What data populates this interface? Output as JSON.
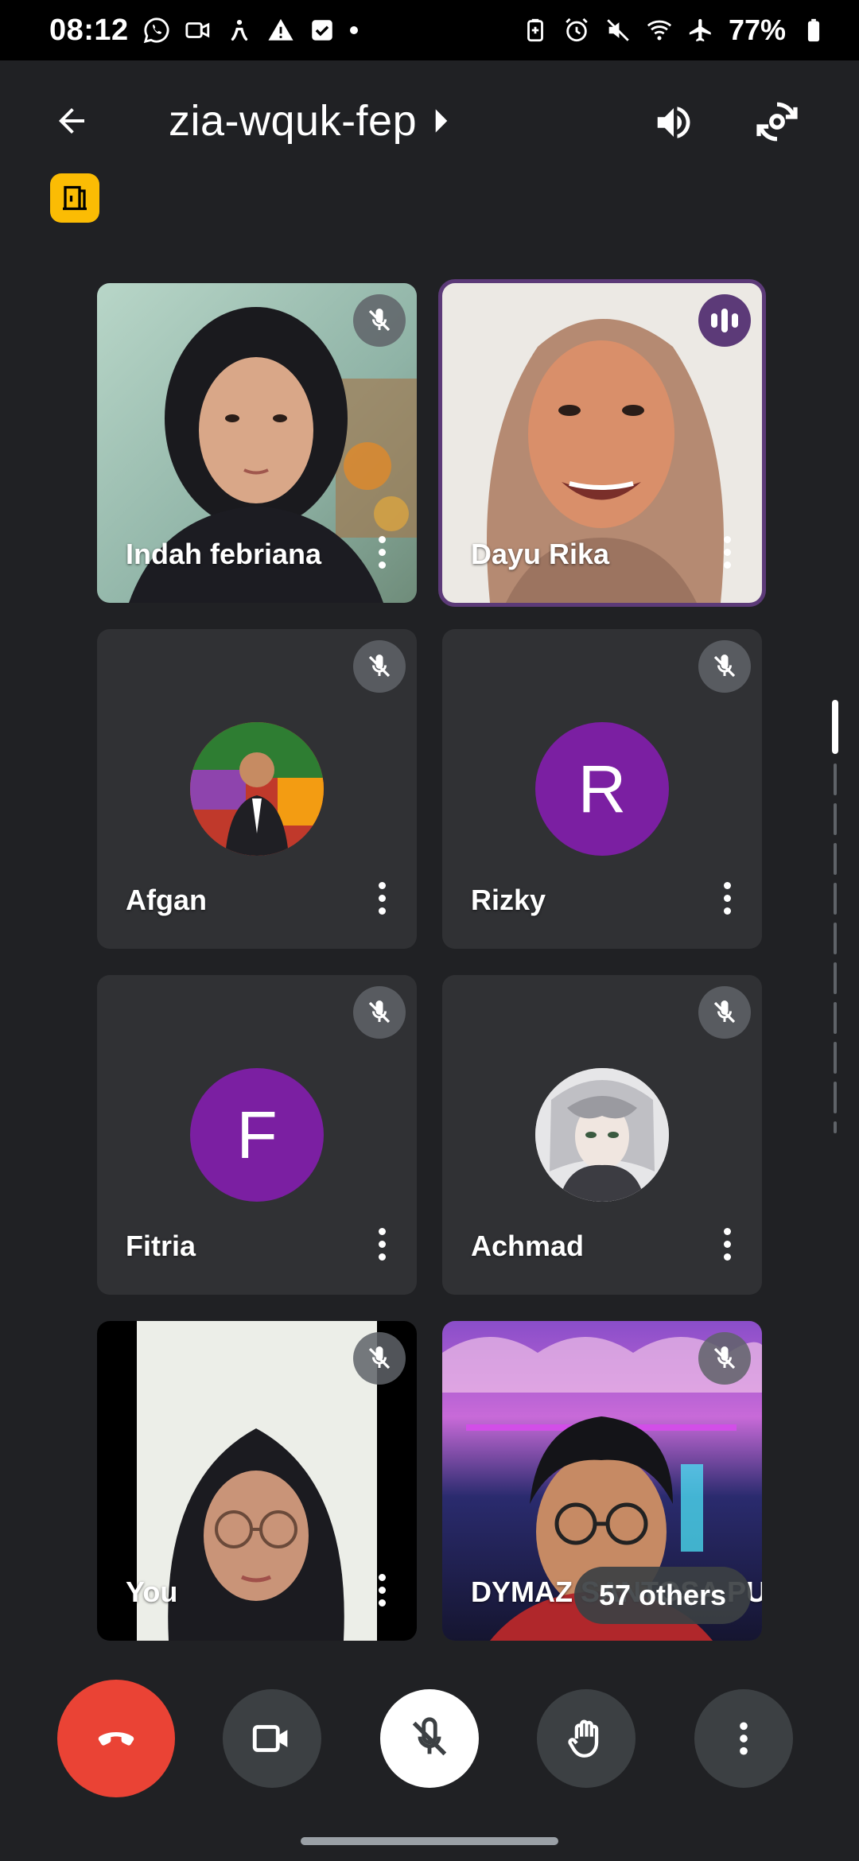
{
  "status_bar": {
    "time": "08:12",
    "battery": "77%",
    "left_icons": [
      "whatsapp-icon",
      "video-call-icon",
      "accessibility-icon",
      "warning-icon",
      "checkbox-icon",
      "notification-dot-icon"
    ],
    "right_icons": [
      "battery-saver-icon",
      "alarm-icon",
      "mute-icon",
      "wifi-icon",
      "airplane-icon",
      "battery-icon"
    ]
  },
  "header": {
    "meeting_code": "zia-wquk-fep",
    "back_icon": "arrow-back-icon",
    "audio_icon": "speaker-icon",
    "flip_camera_icon": "flip-camera-icon",
    "host_badge_icon": "door-icon"
  },
  "participants": [
    {
      "name": "Indah febriana",
      "muted": true,
      "type": "video"
    },
    {
      "name": "Dayu Rika",
      "muted": false,
      "speaking": true,
      "type": "video"
    },
    {
      "name": "Afgan",
      "muted": true,
      "type": "photo-avatar"
    },
    {
      "name": "Rizky",
      "muted": true,
      "type": "initial",
      "initial": "R",
      "color": "#7b1fa2"
    },
    {
      "name": "Fitria",
      "muted": true,
      "type": "initial",
      "initial": "F",
      "color": "#7b1fa2"
    },
    {
      "name": "Achmad",
      "muted": true,
      "type": "photo-avatar"
    },
    {
      "name": "You",
      "muted": true,
      "type": "video"
    },
    {
      "name": "DYMAZ SANTOSA PUTRA",
      "muted": true,
      "type": "video"
    }
  ],
  "others_label": "57 others",
  "controls": {
    "end_call_icon": "end-call-icon",
    "camera_icon": "videocam-icon",
    "mic_icon": "mic-off-icon",
    "raise_hand_icon": "raise-hand-icon",
    "more_icon": "more-vert-icon"
  },
  "colors": {
    "background": "#202124",
    "tile": "#303134",
    "end_call": "#ea4335",
    "speaking": "#5c3a78",
    "host_badge": "#fbbc04",
    "avatar_purple": "#7b1fa2"
  }
}
